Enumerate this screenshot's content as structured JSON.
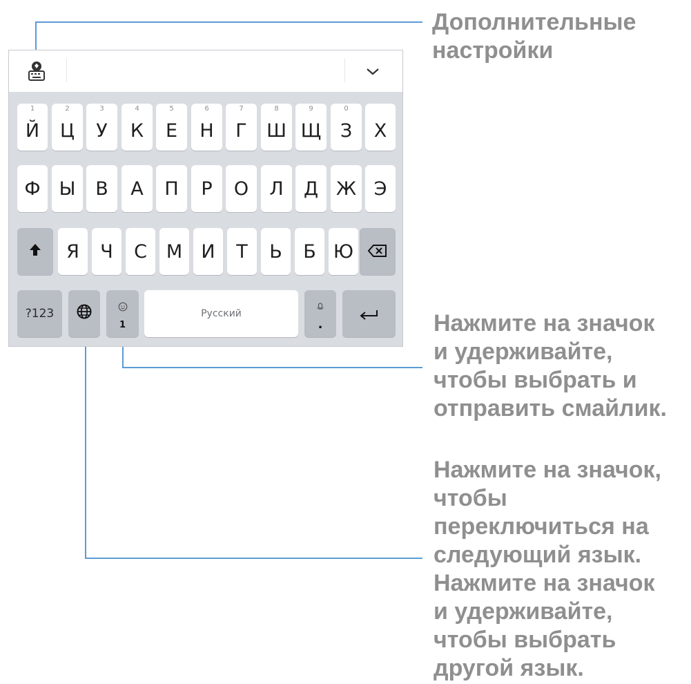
{
  "keyboard": {
    "row1": [
      {
        "hint": "1",
        "label": "Й"
      },
      {
        "hint": "2",
        "label": "Ц"
      },
      {
        "hint": "3",
        "label": "У"
      },
      {
        "hint": "4",
        "label": "К"
      },
      {
        "hint": "5",
        "label": "Е"
      },
      {
        "hint": "6",
        "label": "Н"
      },
      {
        "hint": "7",
        "label": "Г"
      },
      {
        "hint": "8",
        "label": "Ш"
      },
      {
        "hint": "9",
        "label": "Щ"
      },
      {
        "hint": "0",
        "label": "З"
      },
      {
        "hint": "",
        "label": "Х"
      }
    ],
    "row2": [
      "Ф",
      "Ы",
      "В",
      "А",
      "П",
      "Р",
      "О",
      "Л",
      "Д",
      "Ж",
      "Э"
    ],
    "row3": [
      "Я",
      "Ч",
      "С",
      "М",
      "И",
      "Т",
      "Ь",
      "Б",
      "Ю"
    ],
    "symbols_label": "?123",
    "space_label": "Русский",
    "emoji_key_sub": "1",
    "period_key_main": "."
  },
  "annotations": {
    "settings": [
      "Дополнительные",
      "настройки"
    ],
    "emoji": [
      "Нажмите на значок",
      "и удерживайте,",
      "чтобы выбрать и",
      "отправить смайлик."
    ],
    "language": [
      "Нажмите на значок,",
      "чтобы",
      "переключиться на",
      "следующий язык.",
      "Нажмите на значок",
      "и удерживайте,",
      "чтобы выбрать",
      "другой язык."
    ]
  },
  "icons": {
    "settings": "keyboard-settings-icon",
    "collapse": "chevron-down-icon",
    "shift": "shift-arrow-icon",
    "backspace": "backspace-icon",
    "globe": "globe-icon",
    "emoji": "smiley-icon",
    "voice": "microphone-icon",
    "enter": "enter-icon"
  },
  "colors": {
    "callout_line": "#5b9bd5",
    "annotation_text": "#8f8f8f",
    "keyboard_bg": "#d9dce1",
    "key_dark": "#b9bdc4"
  }
}
